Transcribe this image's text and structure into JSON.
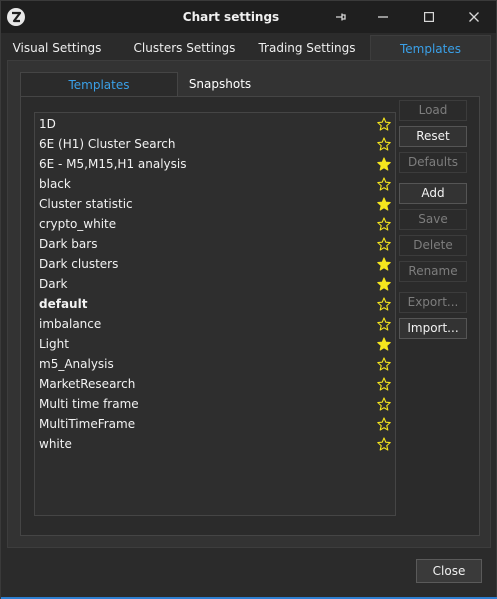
{
  "window": {
    "title": "Chart settings"
  },
  "titlebar_icons": {
    "pin": "pin-icon",
    "minimize": "minimize-icon",
    "maximize": "maximize-icon",
    "close": "close-icon"
  },
  "main_tabs": [
    {
      "label": "Visual Settings",
      "active": false
    },
    {
      "label": "Clusters Settings",
      "active": false
    },
    {
      "label": "Trading Settings",
      "active": false
    },
    {
      "label": "Templates",
      "active": true
    }
  ],
  "inner_tabs": [
    {
      "label": "Templates",
      "active": true
    },
    {
      "label": "Snapshots",
      "active": false
    }
  ],
  "templates": [
    {
      "name": "1D",
      "favorite": false,
      "bold": false
    },
    {
      "name": "6E (H1) Cluster Search",
      "favorite": false,
      "bold": false
    },
    {
      "name": "6E - M5,M15,H1 analysis",
      "favorite": true,
      "bold": false
    },
    {
      "name": "black",
      "favorite": false,
      "bold": false
    },
    {
      "name": "Cluster statistic",
      "favorite": true,
      "bold": false
    },
    {
      "name": "crypto_white",
      "favorite": false,
      "bold": false
    },
    {
      "name": "Dark bars",
      "favorite": false,
      "bold": false
    },
    {
      "name": "Dark clusters",
      "favorite": true,
      "bold": false
    },
    {
      "name": "Dark",
      "favorite": true,
      "bold": false
    },
    {
      "name": "default",
      "favorite": false,
      "bold": true
    },
    {
      "name": "imbalance",
      "favorite": false,
      "bold": false
    },
    {
      "name": "Light",
      "favorite": true,
      "bold": false
    },
    {
      "name": "m5_Analysis",
      "favorite": false,
      "bold": false
    },
    {
      "name": "MarketResearch",
      "favorite": false,
      "bold": false
    },
    {
      "name": "Multi time frame",
      "favorite": false,
      "bold": false
    },
    {
      "name": "MultiTimeFrame",
      "favorite": false,
      "bold": false
    },
    {
      "name": "white",
      "favorite": false,
      "bold": false
    }
  ],
  "side_buttons": [
    {
      "label": "Load",
      "enabled": false
    },
    {
      "label": "Reset",
      "enabled": true
    },
    {
      "label": "Defaults",
      "enabled": false
    },
    {
      "label": "Add",
      "enabled": true
    },
    {
      "label": "Save",
      "enabled": false
    },
    {
      "label": "Delete",
      "enabled": false
    },
    {
      "label": "Rename",
      "enabled": false
    },
    {
      "label": "Export...",
      "enabled": false
    },
    {
      "label": "Import...",
      "enabled": true
    }
  ],
  "footer": {
    "close_label": "Close"
  },
  "colors": {
    "accent": "#3aa0e8",
    "star": "#f5e61e",
    "bottom_line": "#2e7fd1"
  }
}
